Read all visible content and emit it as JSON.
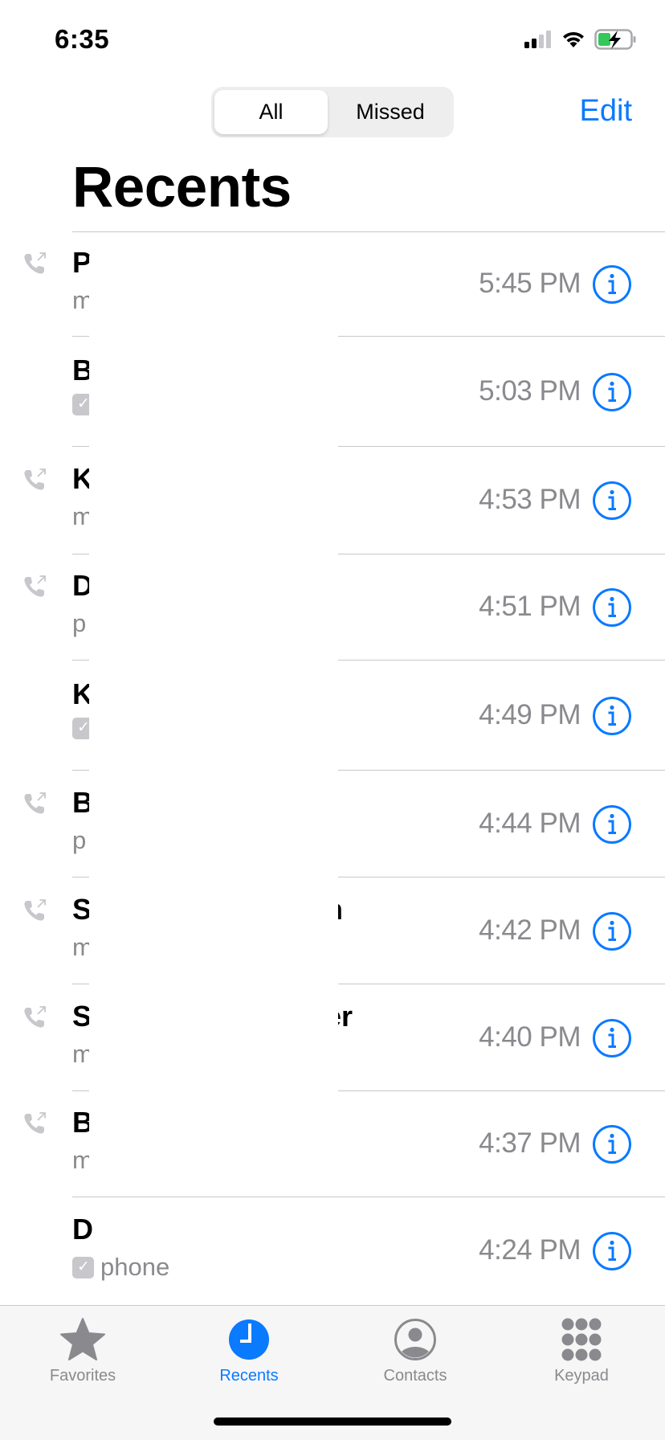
{
  "status_bar": {
    "time": "6:35",
    "signal_bars_filled": 2,
    "signal_bars_total": 4,
    "battery_state": "charging"
  },
  "header": {
    "segments": [
      {
        "label": "All",
        "selected": true
      },
      {
        "label": "Missed",
        "selected": false
      }
    ],
    "edit_label": "Edit",
    "title": "Recents"
  },
  "colors": {
    "accent": "#0a7aff",
    "secondary_text": "#8a8a8e",
    "separator": "#c8c7cc"
  },
  "calls": [
    {
      "name_visible": "P",
      "name_tail": "",
      "subtitle": "m",
      "subtitle_icon": false,
      "outgoing": true,
      "time": "5:45 PM"
    },
    {
      "name_visible": "B",
      "name_tail": "",
      "subtitle": "",
      "subtitle_icon": true,
      "outgoing": false,
      "time": "5:03 PM"
    },
    {
      "name_visible": "K",
      "name_tail": "",
      "subtitle": "m",
      "subtitle_icon": false,
      "outgoing": true,
      "time": "4:53 PM"
    },
    {
      "name_visible": "D",
      "name_tail": "",
      "subtitle": "p",
      "subtitle_icon": false,
      "outgoing": true,
      "time": "4:51 PM"
    },
    {
      "name_visible": "K",
      "name_tail": "",
      "subtitle": "",
      "subtitle_icon": true,
      "outgoing": false,
      "time": "4:49 PM"
    },
    {
      "name_visible": "B",
      "name_tail": "",
      "subtitle": "p",
      "subtitle_icon": false,
      "outgoing": true,
      "time": "4:44 PM"
    },
    {
      "name_visible": "S",
      "name_tail": "n",
      "subtitle": "m",
      "subtitle_icon": false,
      "outgoing": true,
      "time": "4:42 PM"
    },
    {
      "name_visible": "S",
      "name_tail": "er",
      "subtitle": "m",
      "subtitle_icon": false,
      "outgoing": true,
      "time": "4:40 PM"
    },
    {
      "name_visible": "B",
      "name_tail": "",
      "subtitle": "m",
      "subtitle_icon": false,
      "outgoing": true,
      "time": "4:37 PM"
    },
    {
      "name_visible": "D",
      "name_tail": "",
      "subtitle": "phone",
      "subtitle_icon": true,
      "outgoing": false,
      "time": "4:24 PM"
    }
  ],
  "tabbar": {
    "tabs": [
      {
        "label": "Favorites",
        "icon": "star-icon",
        "active": false
      },
      {
        "label": "Recents",
        "icon": "clock-icon",
        "active": true
      },
      {
        "label": "Contacts",
        "icon": "person-circle-icon",
        "active": false
      },
      {
        "label": "Keypad",
        "icon": "keypad-icon",
        "active": false
      }
    ]
  }
}
